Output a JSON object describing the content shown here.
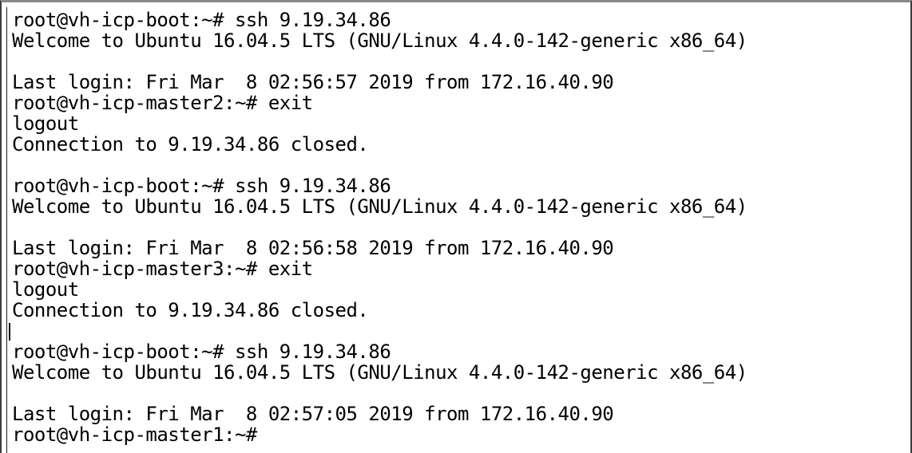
{
  "terminal": {
    "lines": [
      "root@vh-icp-boot:~# ssh 9.19.34.86",
      "Welcome to Ubuntu 16.04.5 LTS (GNU/Linux 4.4.0-142-generic x86_64)",
      "",
      "Last login: Fri Mar  8 02:56:57 2019 from 172.16.40.90",
      "root@vh-icp-master2:~# exit",
      "logout",
      "Connection to 9.19.34.86 closed.",
      "",
      "root@vh-icp-boot:~# ssh 9.19.34.86",
      "Welcome to Ubuntu 16.04.5 LTS (GNU/Linux 4.4.0-142-generic x86_64)",
      "",
      "Last login: Fri Mar  8 02:56:58 2019 from 172.16.40.90",
      "root@vh-icp-master3:~# exit",
      "logout",
      "Connection to 9.19.34.86 closed.",
      "",
      "root@vh-icp-boot:~# ssh 9.19.34.86",
      "Welcome to Ubuntu 16.04.5 LTS (GNU/Linux 4.4.0-142-generic x86_64)",
      "",
      "Last login: Fri Mar  8 02:57:05 2019 from 172.16.40.90",
      "root@vh-icp-master1:~# "
    ],
    "colors": {
      "background": "#ffffff",
      "text": "#000000"
    }
  }
}
